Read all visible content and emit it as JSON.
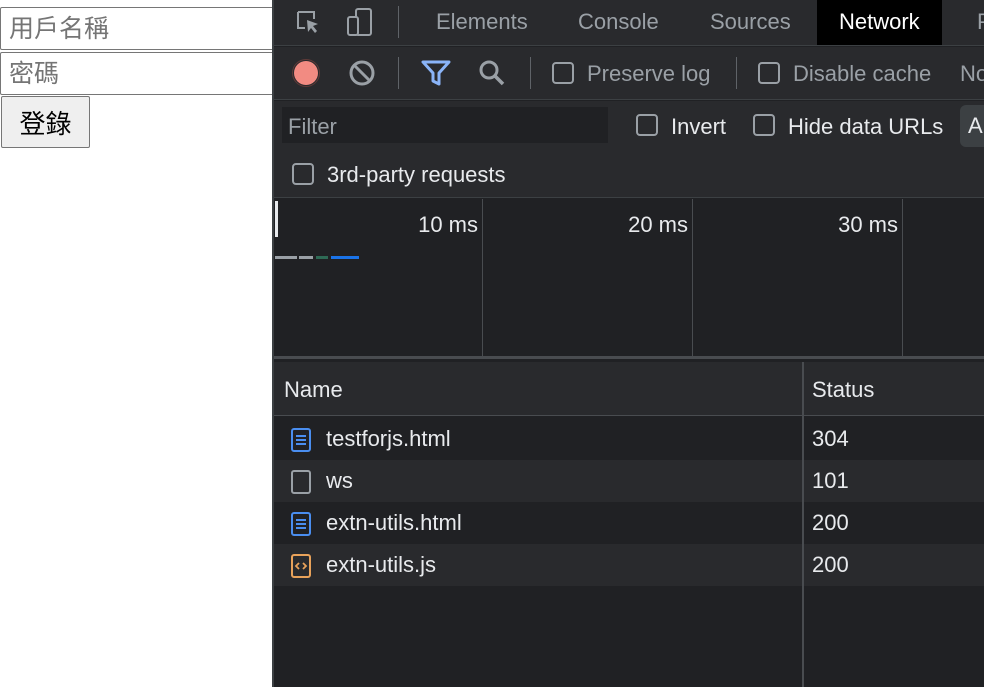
{
  "login": {
    "username_placeholder": "用戶名稱",
    "password_placeholder": "密碼",
    "submit_label": "登錄"
  },
  "devtools": {
    "tabs": [
      {
        "label": "Elements"
      },
      {
        "label": "Console"
      },
      {
        "label": "Sources"
      },
      {
        "label": "Network"
      },
      {
        "label": "P"
      }
    ],
    "active_tab": "Network",
    "toolbar": {
      "preserve_log_label": "Preserve log",
      "disable_cache_label": "Disable cache",
      "throttle_label": "No"
    },
    "filter": {
      "placeholder": "Filter",
      "invert_label": "Invert",
      "hide_data_urls_label": "Hide data URLs",
      "type_all_label": "All",
      "third_party_label": "3rd-party requests"
    },
    "overview": {
      "ticks": [
        "10 ms",
        "20 ms",
        "30 ms"
      ]
    },
    "table": {
      "columns": [
        "Name",
        "Status"
      ],
      "rows": [
        {
          "name": "testforjs.html",
          "status": "304",
          "icon": "document-icon"
        },
        {
          "name": "ws",
          "status": "101",
          "icon": "websocket-icon"
        },
        {
          "name": "extn-utils.html",
          "status": "200",
          "icon": "document-icon"
        },
        {
          "name": "extn-utils.js",
          "status": "200",
          "icon": "script-icon"
        }
      ]
    },
    "colors": {
      "panel_bg": "#202124",
      "toolbar_bg": "#292a2d",
      "record_red": "#f28b82",
      "filter_blue": "#8ab4f8",
      "doc_blue": "#4a8ef0",
      "script_orange": "#e8a25a"
    }
  }
}
